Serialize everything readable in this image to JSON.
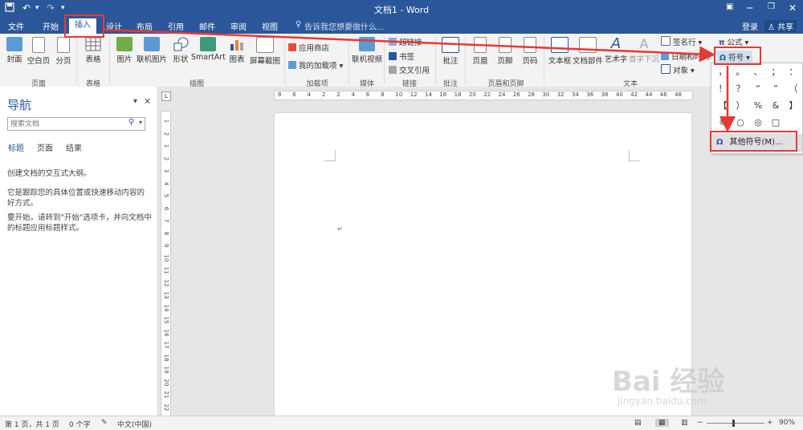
{
  "title_bar": {
    "title": "文档1 - Word",
    "save_icon": "save-icon",
    "undo_icon": "undo-icon",
    "redo_icon": "redo-icon"
  },
  "tabs": [
    "文件",
    "开始",
    "插入",
    "设计",
    "布局",
    "引用",
    "邮件",
    "审阅",
    "视图"
  ],
  "active_tab": "插入",
  "tell_me": "告诉我您想要做什么...",
  "login": "登录",
  "share": "共享",
  "ribbon": {
    "groups": {
      "pages": "页面",
      "tables": "表格",
      "illustrations": "插图",
      "addins": "加载项",
      "media": "媒体",
      "links": "链接",
      "comments": "批注",
      "header_footer": "页眉和页脚",
      "text": "文本"
    },
    "buttons": {
      "cover": "封面",
      "blank": "空白页",
      "page_break": "分页",
      "table": "表格",
      "picture": "图片",
      "online_picture": "联机图片",
      "shapes": "形状",
      "smartart": "SmartArt",
      "chart": "图表",
      "screenshot": "屏幕截图",
      "store": "应用商店",
      "my_addins": "我的加载项",
      "online_video": "联机视频",
      "hyperlink": "超链接",
      "bookmark": "书签",
      "cross_ref": "交叉引用",
      "comment": "批注",
      "header": "页眉",
      "footer": "页脚",
      "page_number": "页码",
      "textbox": "文本框",
      "quick_parts": "文档部件",
      "wordart": "艺术字",
      "dropcap": "首字下沉",
      "signature": "签名行",
      "datetime": "日期和时间",
      "object": "对象",
      "equation": "公式",
      "symbol": "符号"
    }
  },
  "nav": {
    "title": "导航",
    "search_placeholder": "搜索文档",
    "tabs": [
      "标题",
      "页面",
      "结果"
    ],
    "text1": "创建文档的交互式大纲。",
    "text2": "它是跟踪您的具体位置或快速移动内容的好方式。",
    "text3": "要开始，请转到\"开始\"选项卡，并向文档中的标题应用标题样式。"
  },
  "ruler_ticks": [
    "8",
    "6",
    "4",
    "2",
    "2",
    "4",
    "6",
    "8",
    "10",
    "12",
    "14",
    "16",
    "18",
    "20",
    "22",
    "24",
    "26",
    "28",
    "30",
    "32",
    "34",
    "36",
    "38",
    "40",
    "42",
    "44",
    "46",
    "48"
  ],
  "vruler_ticks": [
    "1",
    "2",
    "1",
    "2",
    "3",
    "4",
    "5",
    "6",
    "7",
    "8",
    "9",
    "10",
    "11",
    "12",
    "13",
    "14",
    "15",
    "16",
    "17",
    "18",
    "19",
    "20",
    "21",
    "22"
  ],
  "symbols": [
    "，",
    "。",
    "、",
    "；",
    "：",
    "！",
    "？",
    "“",
    "”",
    "（",
    "【",
    "）",
    "%",
    "&",
    "】",
    "※",
    "○",
    "◎",
    "□"
  ],
  "more_symbols": "其他符号(M)...",
  "status": {
    "page": "第 1 页，共 1 页",
    "words": "0 个字",
    "lang": "中文(中国)",
    "zoom": "90%"
  },
  "watermark": {
    "brand": "Bai  经验",
    "url": "jingyan.baidu.com"
  },
  "colors": {
    "word_blue": "#2b579a",
    "annotation_red": "#e53935"
  }
}
